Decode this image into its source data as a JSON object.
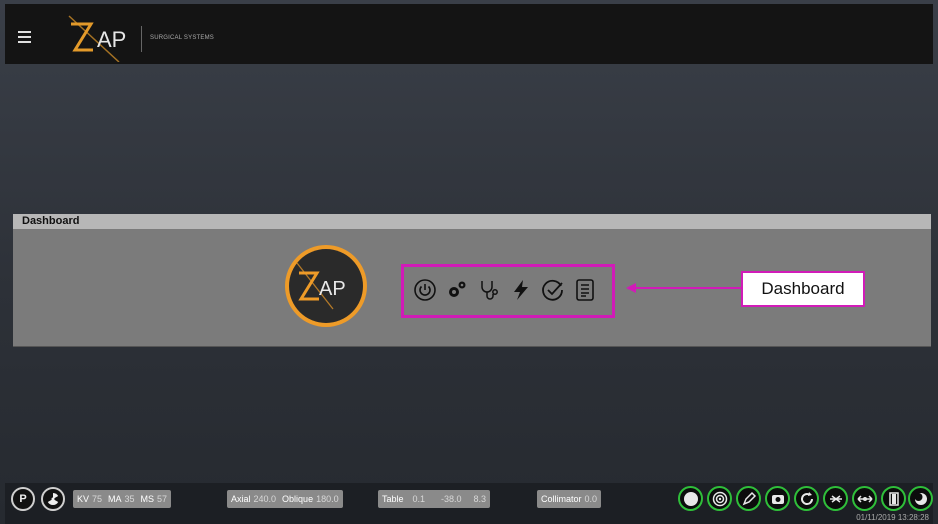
{
  "header": {
    "logo_text": "AP",
    "logo_sub": "SURGICAL SYSTEMS",
    "menu_icon": "hamburger-menu-icon"
  },
  "dashboard": {
    "title": "Dashboard",
    "emblem_text": "AP",
    "icons": [
      "power-icon",
      "gears-icon",
      "stethoscope-icon",
      "bolt-icon",
      "check-circle-icon",
      "document-icon"
    ],
    "callout_label": "Dashboard",
    "highlight_color": "#d11bb8"
  },
  "status_bar": {
    "p_button": "P",
    "radiation_icon": "radiation-icon",
    "kv_label": "KV",
    "kv_value": "75",
    "ma_label": "MA",
    "ma_value": "35",
    "ms_label": "MS",
    "ms_value": "57",
    "axial_label": "Axial",
    "axial_value": "240.0",
    "oblique_label": "Oblique",
    "oblique_value": "180.0",
    "table_label": "Table",
    "table_x": "0.1",
    "table_y": "-38.0",
    "table_z": "8.3",
    "collimator_label": "Collimator",
    "collimator_value": "0.0",
    "right_buttons": [
      "head-icon",
      "target-icon",
      "pen-icon",
      "camera-icon",
      "refresh-icon",
      "couch-icon",
      "arrows-icon",
      "door-icon",
      "moon-icon"
    ],
    "timestamp": "01/11/2019 13:28:28",
    "accent_green": "#2fbf3a"
  }
}
